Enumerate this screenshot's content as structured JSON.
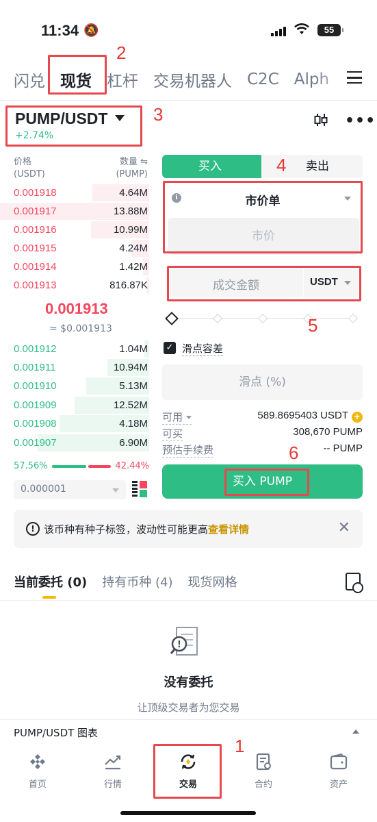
{
  "status": {
    "time": "11:34",
    "battery": "55"
  },
  "top_tabs": [
    {
      "label": "闪兑",
      "active": false
    },
    {
      "label": "现货",
      "active": true
    },
    {
      "label": "杠杆",
      "active": false
    },
    {
      "label": "交易机器人",
      "active": false
    },
    {
      "label": "C2C",
      "active": false
    },
    {
      "label": "Alph",
      "active": false
    }
  ],
  "pair": {
    "symbol": "PUMP/USDT",
    "change": "+2.74%"
  },
  "orderbook": {
    "price_header": "价格",
    "price_unit": "(USDT)",
    "qty_header": "数量",
    "qty_unit": "(PUMP)",
    "asks": [
      {
        "price": "0.001918",
        "qty": "4.64M",
        "depth": 0.38
      },
      {
        "price": "0.001917",
        "qty": "13.88M",
        "depth": 1.0
      },
      {
        "price": "0.001916",
        "qty": "10.99M",
        "depth": 0.39
      },
      {
        "price": "0.001915",
        "qty": "4.24M",
        "depth": 0.12
      },
      {
        "price": "0.001914",
        "qty": "1.42M",
        "depth": 0.04
      },
      {
        "price": "0.001913",
        "qty": "816.87K",
        "depth": 0.02
      }
    ],
    "mid_price": "0.001913",
    "mid_usd": "≈ $0.001913",
    "bids": [
      {
        "price": "0.001912",
        "qty": "1.04M",
        "depth": 0.03
      },
      {
        "price": "0.001911",
        "qty": "10.94M",
        "depth": 0.28
      },
      {
        "price": "0.001910",
        "qty": "5.13M",
        "depth": 0.42
      },
      {
        "price": "0.001909",
        "qty": "12.52M",
        "depth": 0.5
      },
      {
        "price": "0.001908",
        "qty": "4.18M",
        "depth": 0.6
      },
      {
        "price": "0.001907",
        "qty": "6.90M",
        "depth": 0.75
      }
    ],
    "bid_ratio": "57.56%",
    "ask_ratio": "42.44%",
    "bid_ratio_value": 0.5756,
    "precision": "0.000001"
  },
  "trade": {
    "buy_tab": "买入",
    "sell_tab": "卖出",
    "order_type": "市价单",
    "market_price_placeholder": "市价",
    "amount_placeholder": "成交金额",
    "amount_unit": "USDT",
    "slippage_label": "滑点容差",
    "slippage_placeholder": "滑点 (%)",
    "available_label": "可用",
    "available_value": "589.8695403 USDT",
    "can_buy_label": "可买",
    "can_buy_value": "308,670 PUMP",
    "fee_label": "预估手续费",
    "fee_value": "-- PUMP",
    "buy_button": "买入 PUMP"
  },
  "notice": {
    "text": "该币种有种子标签，波动性可能更高",
    "link": "查看详情"
  },
  "bottom_tabs": [
    {
      "label": "当前委托 (0)",
      "active": true
    },
    {
      "label": "持有币种 (4)",
      "active": false
    },
    {
      "label": "现货网格",
      "active": false
    }
  ],
  "empty": {
    "title": "没有委托",
    "subtitle": "让顶级交易者为您交易"
  },
  "chart_bar": {
    "label": "PUMP/USDT 图表"
  },
  "nav": [
    {
      "label": "首页",
      "icon": "home-icon"
    },
    {
      "label": "行情",
      "icon": "markets-icon"
    },
    {
      "label": "交易",
      "icon": "trade-icon"
    },
    {
      "label": "合约",
      "icon": "futures-icon"
    },
    {
      "label": "资产",
      "icon": "wallet-icon"
    }
  ],
  "annotations": [
    "1",
    "2",
    "3",
    "4",
    "5",
    "6"
  ],
  "colors": {
    "green": "#2ebd85",
    "red": "#f6465d",
    "accent": "#f0b90b",
    "annotation": "#e5484d"
  }
}
